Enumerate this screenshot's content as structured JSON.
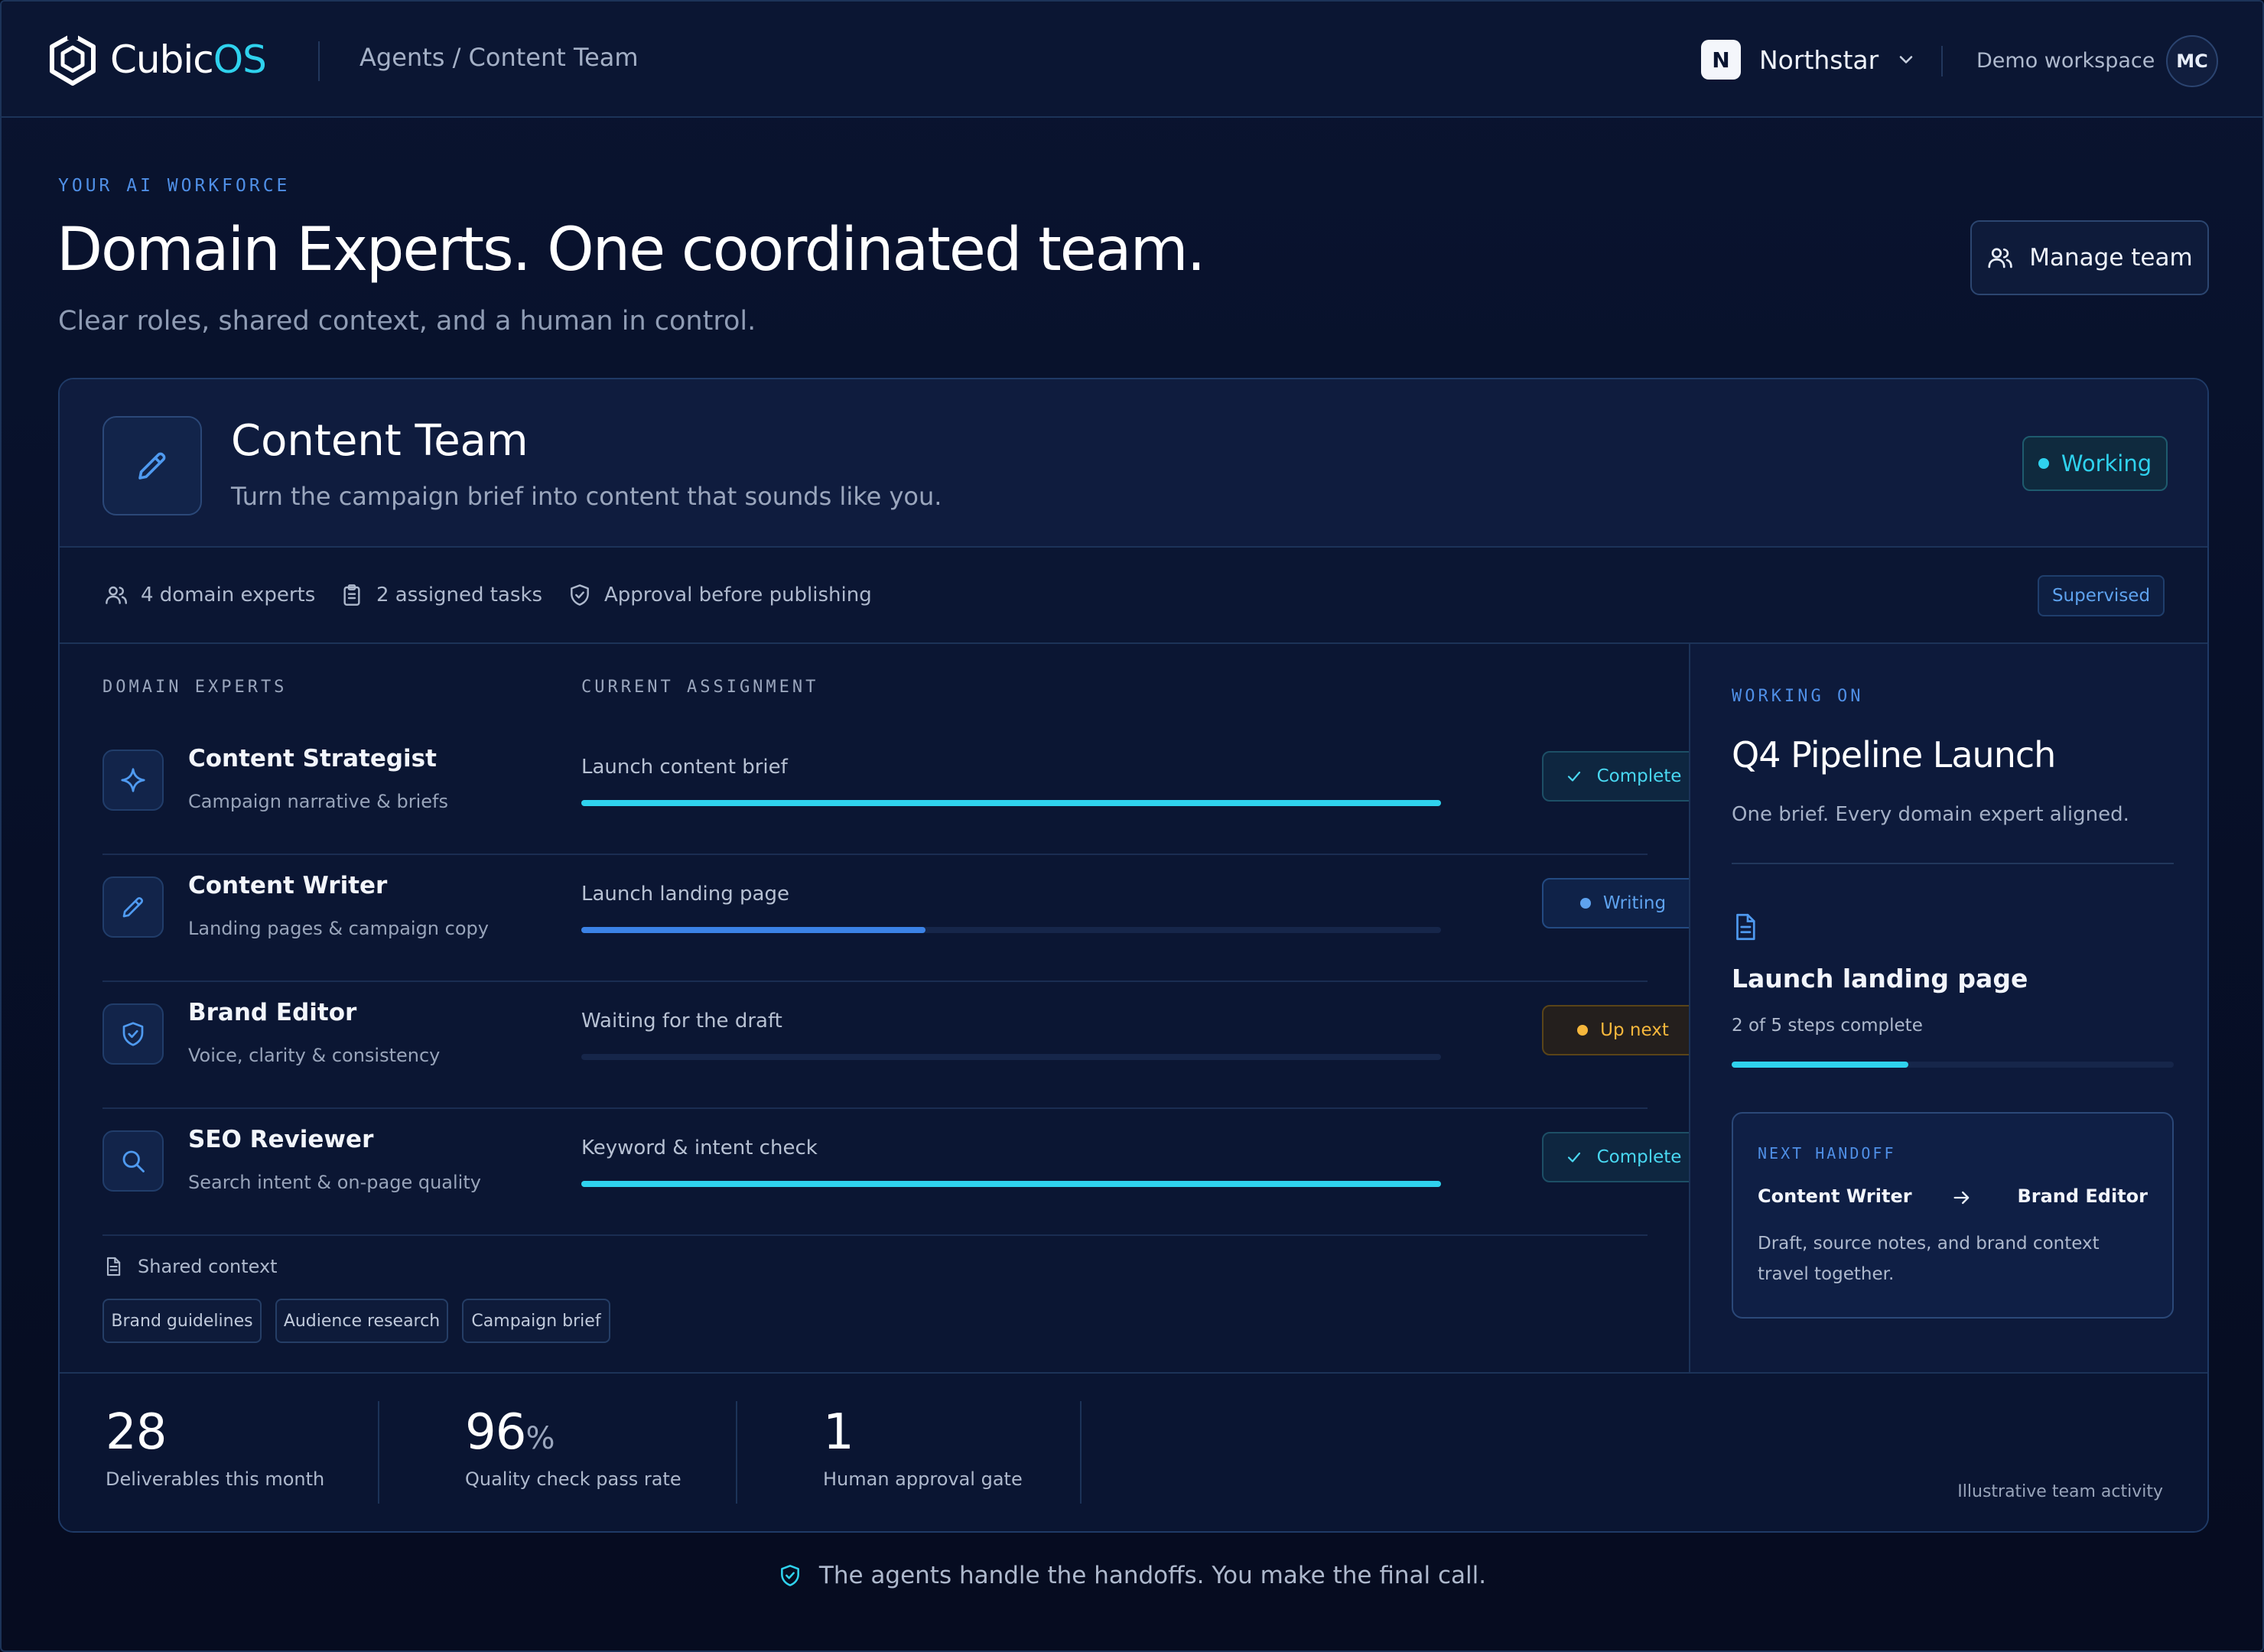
{
  "app": {
    "name_prefix": "Cubic",
    "name_suffix": "OS",
    "logo_icon": "cube-logo-icon"
  },
  "header": {
    "breadcrumb": "Agents / Content Team",
    "org_initial": "N",
    "org_name": "Northstar",
    "workspace": "Demo workspace",
    "avatar_initials": "MC"
  },
  "hero": {
    "eyebrow": "YOUR AI WORKFORCE",
    "headline": "Domain Experts. One coordinated team.",
    "subhead": "Clear roles, shared context, and a human in control.",
    "manage_button": "Manage team"
  },
  "team": {
    "name": "Content Team",
    "description": "Turn the campaign brief into content that sounds like you.",
    "status": "Working",
    "meta": {
      "experts": "4 domain experts",
      "tasks": "2 assigned tasks",
      "approval": "Approval before publishing",
      "mode": "Supervised"
    }
  },
  "columns": {
    "experts": "DOMAIN EXPERTS",
    "assignment": "CURRENT ASSIGNMENT"
  },
  "experts": [
    {
      "name": "Content Strategist",
      "role": "Campaign narrative & briefs",
      "icon": "sparkle-icon",
      "assignment": "Launch content brief",
      "progress": 1.0,
      "status": "Complete",
      "status_kind": "complete"
    },
    {
      "name": "Content Writer",
      "role": "Landing pages & campaign copy",
      "icon": "pencil-icon",
      "assignment": "Launch landing page",
      "progress": 0.4,
      "status": "Writing",
      "status_kind": "writing"
    },
    {
      "name": "Brand Editor",
      "role": "Voice, clarity & consistency",
      "icon": "shield-check-icon",
      "assignment": "Waiting for the draft",
      "progress": 0.0,
      "status": "Up next",
      "status_kind": "upnext"
    },
    {
      "name": "SEO Reviewer",
      "role": "Search intent & on-page quality",
      "icon": "search-icon",
      "assignment": "Keyword & intent check",
      "progress": 1.0,
      "status": "Complete",
      "status_kind": "complete"
    }
  ],
  "shared_context": {
    "label": "Shared context",
    "chips": [
      "Brand guidelines",
      "Audience research",
      "Campaign brief"
    ]
  },
  "working_on": {
    "eyebrow": "WORKING ON",
    "title": "Q4 Pipeline Launch",
    "description": "One brief. Every domain expert aligned.",
    "task_title": "Launch landing page",
    "task_progress_text": "2 of 5 steps complete",
    "task_progress": 0.4,
    "handoff": {
      "eyebrow": "NEXT HANDOFF",
      "from": "Content Writer",
      "to": "Brand Editor",
      "description": "Draft, source notes, and brand context travel together."
    }
  },
  "stats": [
    {
      "value": "28",
      "suffix": "",
      "label": "Deliverables this month"
    },
    {
      "value": "96",
      "suffix": "%",
      "label": "Quality check pass rate"
    },
    {
      "value": "1",
      "suffix": "",
      "label": "Human approval gate"
    }
  ],
  "stats_note": "Illustrative team activity",
  "footer_note": "The agents handle the handoffs. You make the final call.",
  "colors": {
    "accent_cyan": "#2fd2ee",
    "accent_blue": "#4f8fe6",
    "warning": "#f6b73c",
    "background": "#071029"
  }
}
